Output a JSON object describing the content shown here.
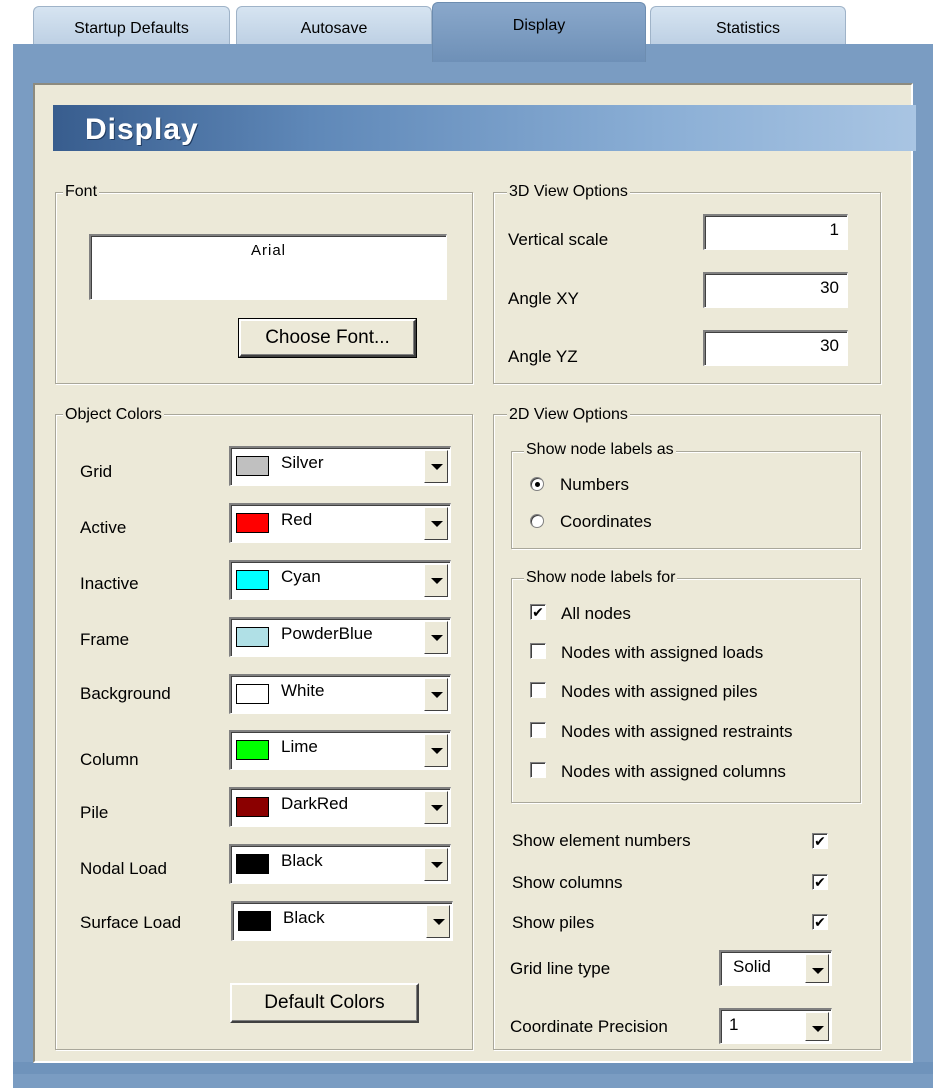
{
  "tabs": [
    {
      "label": "Startup Defaults"
    },
    {
      "label": "Autosave"
    },
    {
      "label": "Display"
    },
    {
      "label": "Statistics"
    }
  ],
  "header": {
    "title": "Display"
  },
  "font_group": {
    "legend": "Font",
    "font_name": "Arial",
    "choose_button": "Choose Font..."
  },
  "view3d": {
    "legend": "3D View Options",
    "vertical_scale_label": "Vertical scale",
    "vertical_scale_value": "1",
    "angle_xy_label": "Angle XY",
    "angle_xy_value": "30",
    "angle_yz_label": "Angle YZ",
    "angle_yz_value": "30"
  },
  "object_colors": {
    "legend": "Object Colors",
    "items": [
      {
        "label": "Grid",
        "value": "Silver",
        "color": "#c0c0c0"
      },
      {
        "label": "Active",
        "value": "Red",
        "color": "#ff0000"
      },
      {
        "label": "Inactive",
        "value": "Cyan",
        "color": "#00ffff"
      },
      {
        "label": "Frame",
        "value": "PowderBlue",
        "color": "#b0e0e6"
      },
      {
        "label": "Background",
        "value": "White",
        "color": "#ffffff"
      },
      {
        "label": "Column",
        "value": "Lime",
        "color": "#00ff00"
      },
      {
        "label": "Pile",
        "value": "DarkRed",
        "color": "#8b0000"
      },
      {
        "label": "Nodal Load",
        "value": "Black",
        "color": "#000000"
      },
      {
        "label": "Surface Load",
        "value": "Black",
        "color": "#000000"
      }
    ],
    "default_button": "Default Colors"
  },
  "view2d": {
    "legend": "2D View Options",
    "labels_as": {
      "legend": "Show node labels as",
      "options": [
        {
          "label": "Numbers",
          "selected": true
        },
        {
          "label": "Coordinates",
          "selected": false
        }
      ]
    },
    "labels_for": {
      "legend": "Show node labels for",
      "options": [
        {
          "label": "All nodes",
          "checked": true
        },
        {
          "label": "Nodes with assigned loads",
          "checked": false
        },
        {
          "label": "Nodes with assigned piles",
          "checked": false
        },
        {
          "label": "Nodes with assigned restraints",
          "checked": false
        },
        {
          "label": "Nodes with assigned columns",
          "checked": false
        }
      ]
    },
    "show_element_numbers": {
      "label": "Show element numbers",
      "checked": true
    },
    "show_columns": {
      "label": "Show columns",
      "checked": true
    },
    "show_piles": {
      "label": "Show piles",
      "checked": true
    },
    "grid_line_type": {
      "label": "Grid line type",
      "value": "Solid"
    },
    "coordinate_precision": {
      "label": "Coordinate Precision",
      "value": "1"
    },
    "check_mark": "✔"
  }
}
